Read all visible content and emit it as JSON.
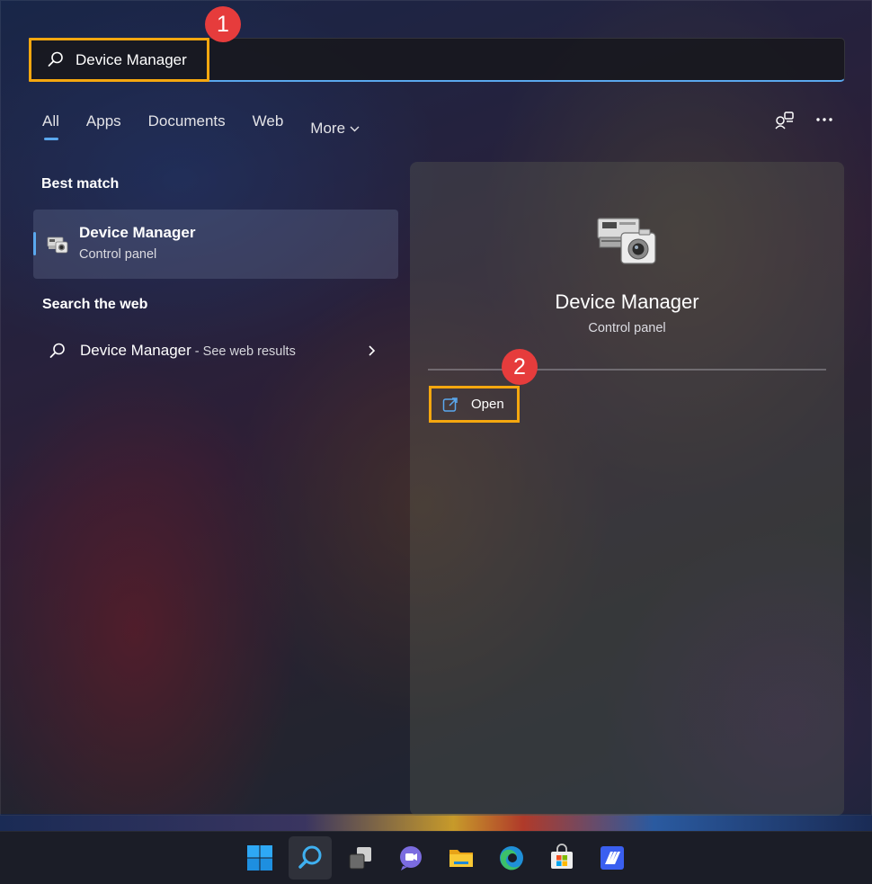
{
  "search": {
    "value": "Device Manager",
    "icon": "search-icon"
  },
  "callouts": {
    "one": "1",
    "two": "2"
  },
  "tabs": [
    {
      "label": "All",
      "active": true
    },
    {
      "label": "Apps"
    },
    {
      "label": "Documents"
    },
    {
      "label": "Web"
    },
    {
      "label": "More"
    }
  ],
  "best_match": {
    "section_title": "Best match",
    "title": "Device Manager",
    "subtitle": "Control panel"
  },
  "search_web": {
    "section_title": "Search the web",
    "query": "Device Manager",
    "suffix": " - See web results"
  },
  "preview": {
    "title": "Device Manager",
    "subtitle": "Control panel",
    "action_label": "Open"
  },
  "colors": {
    "accent": "#5aa8ee",
    "highlight": "#f5a70f",
    "callout": "#e63c3c"
  }
}
